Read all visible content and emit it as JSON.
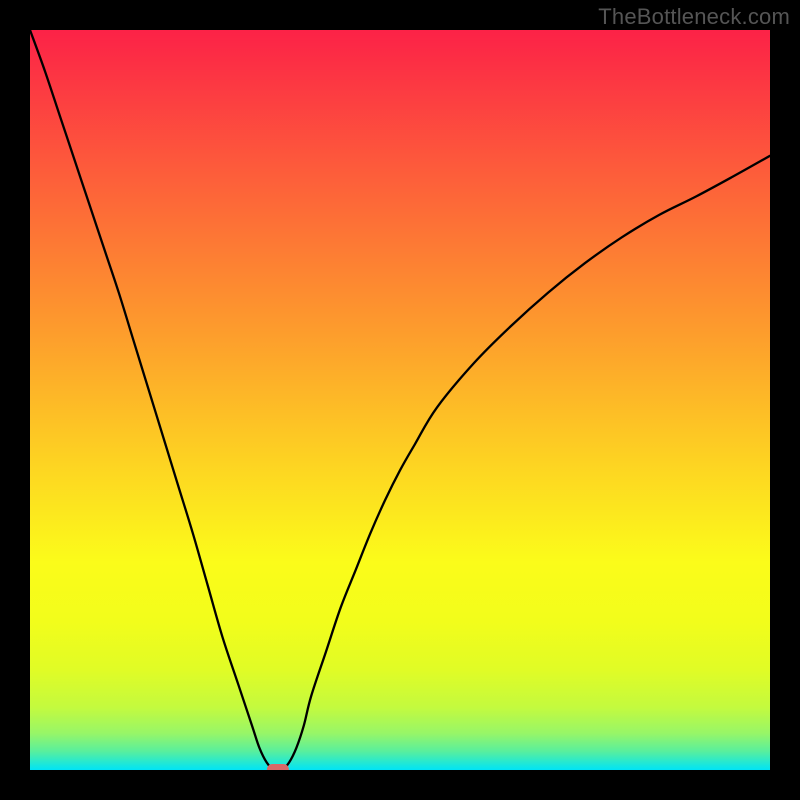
{
  "watermark": "TheBottleneck.com",
  "chart_data": {
    "type": "line",
    "title": "",
    "xlabel": "",
    "ylabel": "",
    "xlim": [
      0,
      100
    ],
    "ylim": [
      0,
      100
    ],
    "grid": false,
    "background": "gradient red-yellow-green (top→bottom)",
    "series": [
      {
        "name": "curve",
        "x": [
          0,
          2,
          4,
          6,
          8,
          10,
          12,
          14,
          16,
          18,
          20,
          22,
          24,
          26,
          28,
          30,
          31,
          32,
          33,
          34,
          35,
          36,
          37,
          38,
          40,
          42,
          44,
          46,
          48,
          50,
          52,
          55,
          60,
          65,
          70,
          75,
          80,
          85,
          90,
          95,
          100
        ],
        "y": [
          100,
          94.5,
          88.5,
          82.5,
          76.5,
          70.5,
          64.5,
          58,
          51.5,
          45,
          38.5,
          32,
          25,
          18,
          12,
          6,
          3,
          1,
          0,
          0,
          1,
          3,
          6,
          10,
          16,
          22,
          27,
          32,
          36.5,
          40.5,
          44,
          49,
          55,
          60,
          64.5,
          68.5,
          72,
          75,
          77.5,
          80.2,
          83
        ]
      }
    ],
    "marker": {
      "x": 33.5,
      "y": 0,
      "color": "#d86868"
    },
    "gradient_stops": [
      {
        "pos": 0.0,
        "color": "#fc2247"
      },
      {
        "pos": 0.2,
        "color": "#fd5f3a"
      },
      {
        "pos": 0.4,
        "color": "#fd9a2d"
      },
      {
        "pos": 0.6,
        "color": "#fdd821"
      },
      {
        "pos": 0.72,
        "color": "#fbfc1a"
      },
      {
        "pos": 0.8,
        "color": "#f2fd1b"
      },
      {
        "pos": 0.865,
        "color": "#e0fc26"
      },
      {
        "pos": 0.915,
        "color": "#c4fa3e"
      },
      {
        "pos": 0.95,
        "color": "#98f667"
      },
      {
        "pos": 0.975,
        "color": "#58ef9e"
      },
      {
        "pos": 1.0,
        "color": "#00e4f6"
      }
    ]
  }
}
